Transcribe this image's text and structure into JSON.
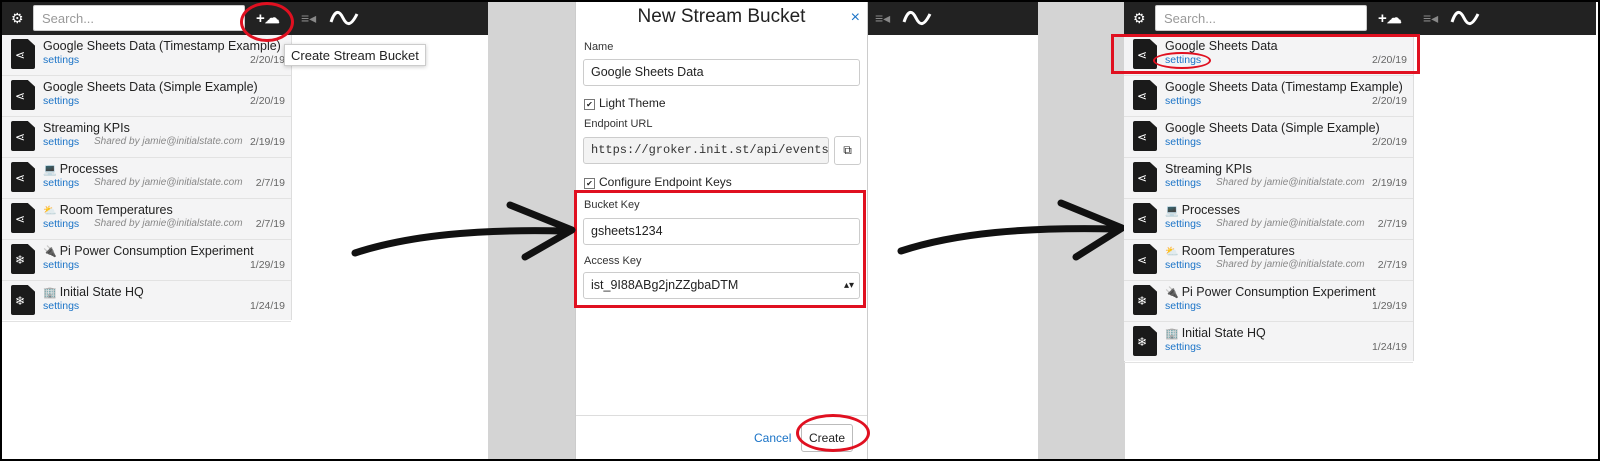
{
  "search": {
    "placeholder": "Search..."
  },
  "icons": {
    "gear": "⚙",
    "plus": "+☁",
    "menu": "≡◂",
    "doc_share": "⋖",
    "doc_rpi": "❄"
  },
  "left_list": [
    {
      "name": "Google Sheets Data (Timestamp Example)",
      "settings": "settings",
      "shared": "",
      "date": "2/20/19",
      "emoji": ""
    },
    {
      "name": "Google Sheets Data (Simple Example)",
      "settings": "settings",
      "shared": "",
      "date": "2/20/19",
      "emoji": ""
    },
    {
      "name": "Streaming KPIs",
      "settings": "settings",
      "shared": "Shared by jamie@initialstate.com",
      "date": "2/19/19",
      "emoji": ""
    },
    {
      "name": "Processes",
      "settings": "settings",
      "shared": "Shared by jamie@initialstate.com",
      "date": "2/7/19",
      "emoji": "💻"
    },
    {
      "name": "Room Temperatures",
      "settings": "settings",
      "shared": "Shared by jamie@initialstate.com",
      "date": "2/7/19",
      "emoji": "⛅"
    },
    {
      "name": "Pi Power Consumption Experiment",
      "settings": "settings",
      "shared": "",
      "date": "1/29/19",
      "emoji": "🔌"
    },
    {
      "name": "Initial State HQ",
      "settings": "settings",
      "shared": "",
      "date": "1/24/19",
      "emoji": "🏢"
    }
  ],
  "tooltip": "Create Stream Bucket",
  "modal": {
    "title": "New Stream Bucket",
    "close": "×",
    "name_label": "Name",
    "name_value": "Google Sheets Data",
    "light_theme": "Light Theme",
    "endpoint_label": "Endpoint URL",
    "endpoint_value": "https://groker.init.st/api/events?",
    "configure_keys": "Configure Endpoint Keys",
    "bucket_key_label": "Bucket Key",
    "bucket_key_value": "gsheets1234",
    "access_key_label": "Access Key",
    "access_key_value": "ist_9I88ABg2jnZZgbaDTM",
    "select_arrows": "▴▾",
    "cancel": "Cancel",
    "create": "Create",
    "check": "✔"
  },
  "right_list": [
    {
      "name": "Google Sheets Data",
      "settings": "settings",
      "shared": "",
      "date": "2/20/19",
      "emoji": ""
    },
    {
      "name": "Google Sheets Data (Timestamp Example)",
      "settings": "settings",
      "shared": "",
      "date": "2/20/19",
      "emoji": ""
    },
    {
      "name": "Google Sheets Data (Simple Example)",
      "settings": "settings",
      "shared": "",
      "date": "2/20/19",
      "emoji": ""
    },
    {
      "name": "Streaming KPIs",
      "settings": "settings",
      "shared": "Shared by jamie@initialstate.com",
      "date": "2/19/19",
      "emoji": ""
    },
    {
      "name": "Processes",
      "settings": "settings",
      "shared": "Shared by jamie@initialstate.com",
      "date": "2/7/19",
      "emoji": "💻"
    },
    {
      "name": "Room Temperatures",
      "settings": "settings",
      "shared": "Shared by jamie@initialstate.com",
      "date": "2/7/19",
      "emoji": "⛅"
    },
    {
      "name": "Pi Power Consumption Experiment",
      "settings": "settings",
      "shared": "",
      "date": "1/29/19",
      "emoji": "🔌"
    },
    {
      "name": "Initial State HQ",
      "settings": "settings",
      "shared": "",
      "date": "1/24/19",
      "emoji": "🏢"
    }
  ],
  "colors": {
    "highlight": "#e01020",
    "link": "#1a73c7",
    "topbar": "#222222"
  }
}
